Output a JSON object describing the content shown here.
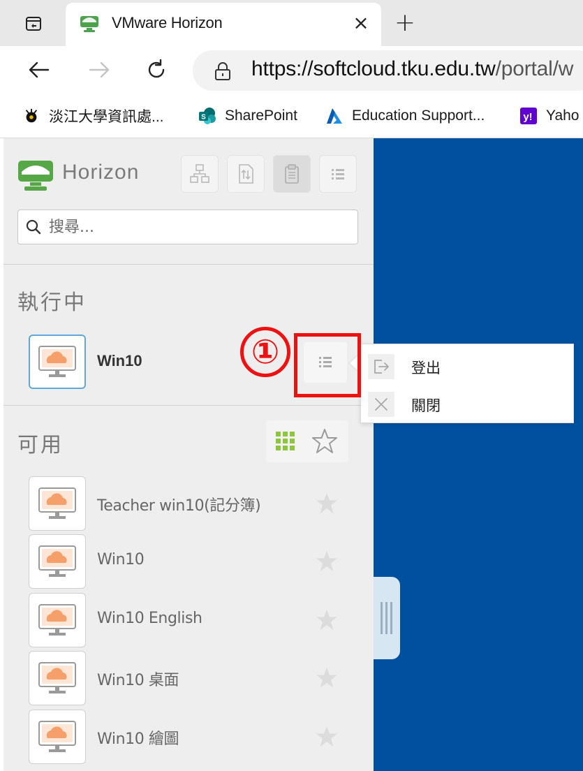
{
  "browser": {
    "tab_title": "VMware Horizon",
    "close_glyph": "×",
    "new_tab_glyph": "+",
    "url_main": "https://softcloud.tku.edu.tw",
    "url_path": "/portal/w",
    "bookmarks": [
      {
        "label": "淡江大學資訊處...",
        "icon": "tku-icon"
      },
      {
        "label": "SharePoint",
        "icon": "sharepoint-icon"
      },
      {
        "label": "Education Support...",
        "icon": "azure-icon"
      },
      {
        "label": "Yaho",
        "icon": "yahoo-icon"
      }
    ]
  },
  "sidebar": {
    "brand": "Horizon",
    "search_placeholder": "搜尋...",
    "running_title": "執行中",
    "running_items": [
      {
        "label": "Win10"
      }
    ],
    "available_title": "可用",
    "apps": [
      {
        "label": "Teacher win10(記分簿)"
      },
      {
        "label": "Win10"
      },
      {
        "label": "Win10 English"
      },
      {
        "label": "Win10 桌面"
      },
      {
        "label": "Win10 繪圖"
      }
    ]
  },
  "context_menu": {
    "items": [
      {
        "label": "登出",
        "icon": "logout-icon"
      },
      {
        "label": "關閉",
        "icon": "close-icon"
      }
    ]
  },
  "annotation": {
    "step": "①",
    "color": "#ee1111"
  },
  "colors": {
    "desktop_bg": "#0050a0",
    "accent_green": "#8cc63f",
    "app_orange": "#f5a06a",
    "selection_blue": "#5fa8dd"
  }
}
